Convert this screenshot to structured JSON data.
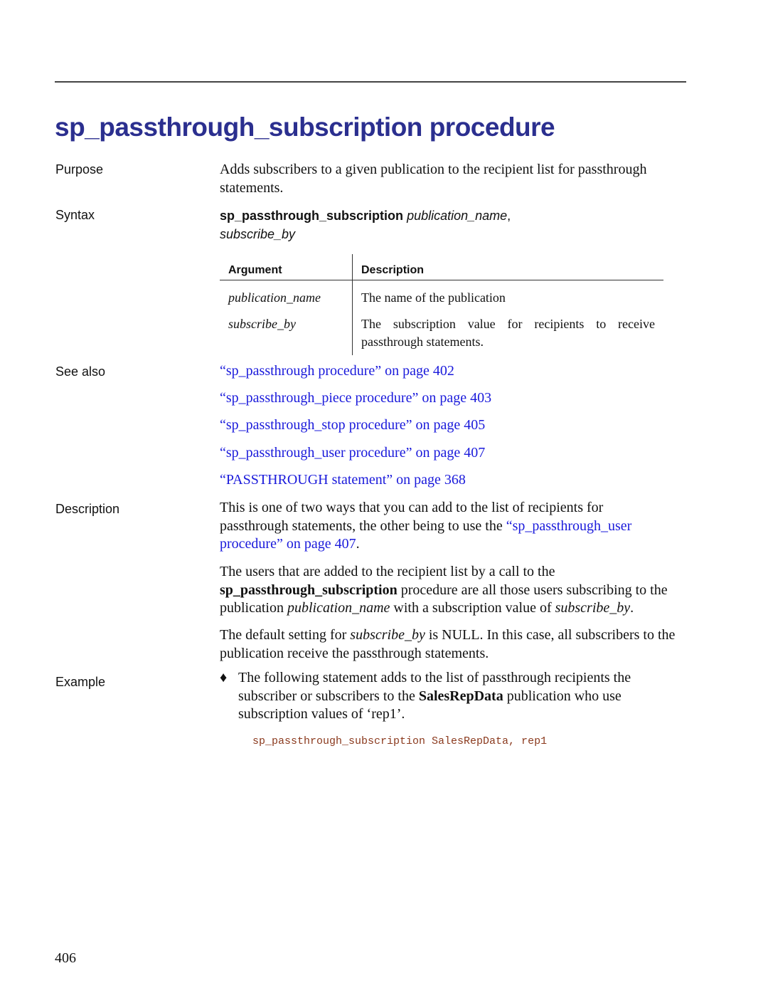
{
  "title": "sp_passthrough_subscription procedure",
  "labels": {
    "purpose": "Purpose",
    "syntax": "Syntax",
    "see_also": "See also",
    "description": "Description",
    "example": "Example"
  },
  "purpose": "Adds subscribers to a given publication to the recipient list for passthrough statements.",
  "syntax": {
    "name": "sp_passthrough_subscription",
    "arg1": "publication_name",
    "sep": ",",
    "arg2": "subscribe_by"
  },
  "table": {
    "headers": [
      "Argument",
      "Description"
    ],
    "rows": [
      {
        "arg": "publication_name",
        "desc": "The name of the publication"
      },
      {
        "arg": "subscribe_by",
        "desc": "The subscription value for recipients to receive passthrough statements."
      }
    ]
  },
  "see_also": [
    "“sp_passthrough procedure” on page 402",
    "“sp_passthrough_piece procedure” on page 403",
    "“sp_passthrough_stop procedure” on page 405",
    "“sp_passthrough_user procedure” on page 407",
    "“PASSTHROUGH statement” on page 368"
  ],
  "description": {
    "p1_a": "This is one of two ways that you can add to the list of recipients for passthrough statements, the other being to use the ",
    "p1_link": "“sp_passthrough_user procedure” on page 407",
    "p1_b": ".",
    "p2_a": "The users that are added to the recipient list by a call to the ",
    "p2_bold": "sp_passthrough_subscription",
    "p2_b": " procedure are all those users subscribing to the publication ",
    "p2_i1": "publication_name",
    "p2_c": " with a subscription value of ",
    "p2_i2": "subscribe_by",
    "p2_d": ".",
    "p3_a": "The default setting for ",
    "p3_i": "subscribe_by",
    "p3_b": " is NULL. In this case, all subscribers to the publication receive the passthrough statements."
  },
  "example": {
    "bullet": "♦",
    "t1": "The following statement adds to the list of passthrough recipients the subscriber or subscribers to the ",
    "bold": "SalesRepData",
    "t2": " publication who use subscription values of ‘rep1’.",
    "code": "sp_passthrough_subscription SalesRepData, rep1"
  },
  "page_number": "406"
}
